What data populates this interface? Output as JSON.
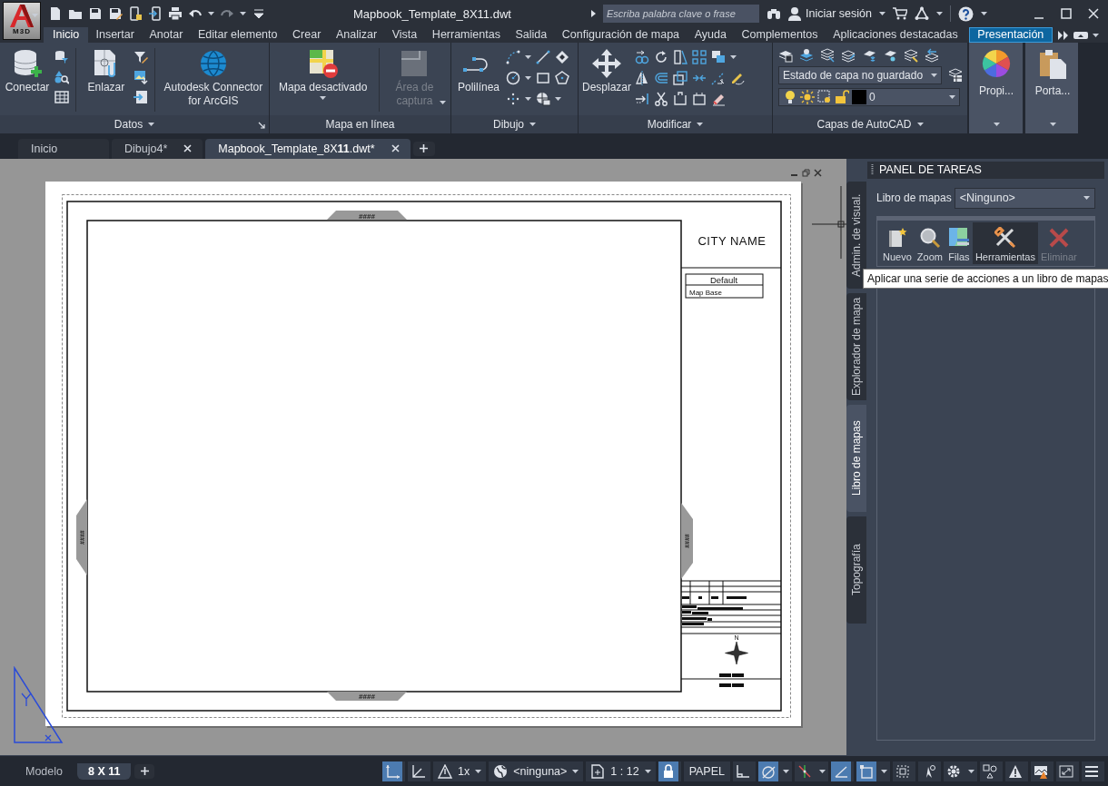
{
  "app_button": {
    "label": "M3D"
  },
  "window": {
    "title": "Mapbook_Template_8X11.dwt"
  },
  "search": {
    "placeholder": "Escriba palabra clave o frase"
  },
  "account": {
    "label": "Iniciar sesión"
  },
  "ribbon_tabs": [
    {
      "label": "Inicio",
      "selected": true,
      "highlighted": false
    },
    {
      "label": "Insertar",
      "selected": false,
      "highlighted": false
    },
    {
      "label": "Anotar",
      "selected": false,
      "highlighted": false
    },
    {
      "label": "Editar elemento",
      "selected": false,
      "highlighted": false
    },
    {
      "label": "Crear",
      "selected": false,
      "highlighted": false
    },
    {
      "label": "Analizar",
      "selected": false,
      "highlighted": false
    },
    {
      "label": "Vista",
      "selected": false,
      "highlighted": false
    },
    {
      "label": "Herramientas",
      "selected": false,
      "highlighted": false
    },
    {
      "label": "Salida",
      "selected": false,
      "highlighted": false
    },
    {
      "label": "Configuración de mapa",
      "selected": false,
      "highlighted": false
    },
    {
      "label": "Ayuda",
      "selected": false,
      "highlighted": false
    },
    {
      "label": "Complementos",
      "selected": false,
      "highlighted": false
    },
    {
      "label": "Aplicaciones destacadas",
      "selected": false,
      "highlighted": false
    },
    {
      "label": "Presentación",
      "selected": false,
      "highlighted": true
    }
  ],
  "ribbon_panels": [
    {
      "title": "Datos",
      "menu": true,
      "launcher": true,
      "tools": [
        {
          "label": "Conectar",
          "dropdown": false,
          "disabled": false
        },
        {
          "label": "Enlazar",
          "dropdown": false,
          "disabled": false
        },
        {
          "label": "Autodesk Connector for ArcGIS",
          "dropdown": false,
          "disabled": false
        }
      ]
    },
    {
      "title": "Mapa en línea",
      "menu": false,
      "launcher": false,
      "tools": [
        {
          "label": "Mapa desactivado",
          "dropdown": true,
          "disabled": false
        },
        {
          "label": "Área de captura",
          "dropdown": true,
          "disabled": true
        }
      ]
    },
    {
      "title": "Dibujo",
      "menu": true,
      "launcher": false,
      "tools": [
        {
          "label": "Polilínea",
          "dropdown": false,
          "disabled": false
        }
      ]
    },
    {
      "title": "Modificar",
      "menu": true,
      "launcher": false,
      "tools": [
        {
          "label": "Desplazar",
          "dropdown": false,
          "disabled": false
        }
      ]
    },
    {
      "title": "Capas de AutoCAD",
      "menu": true,
      "launcher": false,
      "layer_state": "Estado de capa no guardado",
      "current_layer": "0"
    },
    {
      "tools": [
        {
          "label": "Propi...",
          "dropdown": true,
          "disabled": false
        }
      ]
    },
    {
      "tools": [
        {
          "label": "Porta...",
          "dropdown": true,
          "disabled": false
        }
      ]
    }
  ],
  "doc_tabs": [
    {
      "label": "Inicio",
      "selected": false,
      "closable": false
    },
    {
      "label": "Dibujo4*",
      "selected": false,
      "closable": true
    },
    {
      "label": "Mapbook_Template_8X**11**.dwt*",
      "selected": true,
      "closable": true
    }
  ],
  "drawing": {
    "city_name": "CITY NAME",
    "legend": {
      "title": "Default",
      "items": [
        "Map Base"
      ]
    },
    "edge_labels": [
      "####",
      "####",
      "####",
      "####"
    ],
    "north_label": "N"
  },
  "side_tabs": [
    {
      "label": "Admin. de visual.",
      "selected": false
    },
    {
      "label": "Explorador de mapa",
      "selected": false
    },
    {
      "label": "Libro de mapas",
      "selected": true
    },
    {
      "label": "Topografía",
      "selected": false
    }
  ],
  "task_panel": {
    "title": "PANEL DE TAREAS",
    "mapbook_label": "Libro de mapas",
    "mapbook_value": "<Ninguno>",
    "tools": [
      {
        "label": "Nuevo",
        "disabled": false,
        "hovered": false
      },
      {
        "label": "Zoom",
        "disabled": false,
        "hovered": false
      },
      {
        "label": "Filas",
        "disabled": false,
        "hovered": false
      },
      {
        "label": "Herramientas",
        "disabled": false,
        "hovered": true
      },
      {
        "label": "Eliminar",
        "disabled": true,
        "hovered": false
      }
    ],
    "tooltip": "Aplicar una serie de acciones a un libro de mapas"
  },
  "layout_tabs": [
    {
      "label": "Modelo",
      "selected": false
    },
    {
      "label": "8 X 11",
      "selected": true
    }
  ],
  "status_items": [
    {
      "kind": "toggle",
      "on": true,
      "menu": false
    },
    {
      "kind": "toggle",
      "on": false,
      "menu": false
    },
    {
      "kind": "dropdown",
      "label": "1x"
    },
    {
      "kind": "dropdown",
      "label": "<ninguna>"
    },
    {
      "kind": "dropdown",
      "label": "1 : 12"
    },
    {
      "kind": "toggle",
      "on": true,
      "menu": false
    },
    {
      "kind": "button",
      "label": "PAPEL"
    },
    {
      "kind": "toggle",
      "on": false,
      "menu": false
    },
    {
      "kind": "toggle",
      "on": true,
      "menu": true
    },
    {
      "kind": "toggle",
      "on": false,
      "menu": true
    },
    {
      "kind": "toggle",
      "on": true,
      "menu": false
    },
    {
      "kind": "toggle",
      "on": true,
      "menu": true
    },
    {
      "kind": "toggle",
      "on": false,
      "menu": false
    },
    {
      "kind": "toggle",
      "on": false,
      "menu": false
    },
    {
      "kind": "toggle",
      "on": false,
      "menu": true
    },
    {
      "kind": "toggle",
      "on": false,
      "menu": false
    },
    {
      "kind": "toggle",
      "on": false,
      "menu": false
    },
    {
      "kind": "toggle",
      "on": false,
      "menu": false
    },
    {
      "kind": "toggle",
      "on": false,
      "menu": false
    },
    {
      "kind": "toggle",
      "on": false,
      "menu": false
    }
  ]
}
